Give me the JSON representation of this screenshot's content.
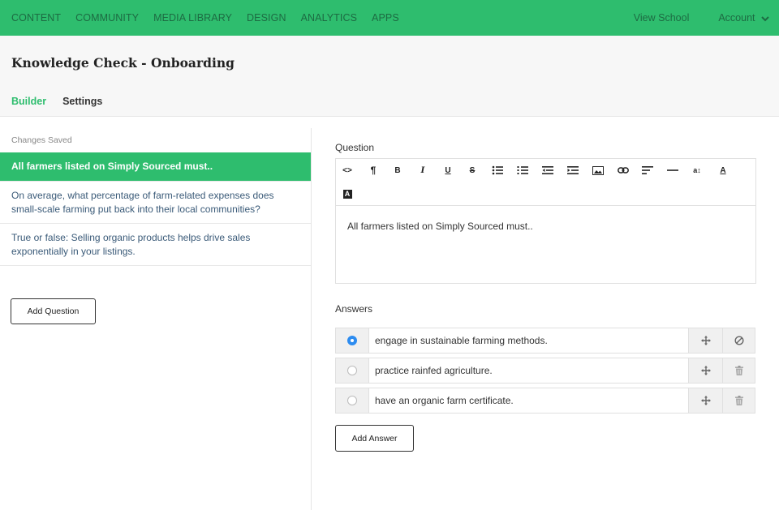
{
  "nav": {
    "left": [
      "CONTENT",
      "COMMUNITY",
      "MEDIA LIBRARY",
      "DESIGN",
      "ANALYTICS",
      "APPS"
    ],
    "view_school": "View School",
    "account": "Account"
  },
  "header": {
    "title": "Knowledge Check - Onboarding",
    "tabs": [
      {
        "label": "Builder",
        "active": true
      },
      {
        "label": "Settings",
        "active": false
      }
    ]
  },
  "sidebar": {
    "status": "Changes Saved",
    "questions": [
      "All farmers listed on Simply Sourced must..",
      "On average, what percentage of farm-related expenses does small-scale farming put back into their local communities?",
      "True or false: Selling organic products helps drive sales exponentially in your listings."
    ],
    "add_question": "Add Question"
  },
  "editor": {
    "question_label": "Question",
    "content": "All farmers listed on Simply Sourced must..",
    "toolbar_icons": [
      "code-icon",
      "paragraph-icon",
      "bold-icon",
      "italic-icon",
      "underline-icon",
      "strikethrough-icon",
      "unordered-list-icon",
      "ordered-list-icon",
      "outdent-icon",
      "indent-icon",
      "image-icon",
      "link-icon",
      "align-icon",
      "horizontal-rule-icon",
      "font-size-icon",
      "font-color-icon",
      "background-color-icon"
    ],
    "toolbar_glyphs": {
      "code": "<>",
      "paragraph": "¶",
      "bold": "B",
      "italic": "I",
      "underline": "U",
      "strike": "S",
      "font_size": "a↕",
      "font_color": "A",
      "bg_color": "A"
    }
  },
  "answers": {
    "label": "Answers",
    "items": [
      {
        "text": "engage in sustainable farming methods.",
        "correct": true
      },
      {
        "text": "practice rainfed agriculture.",
        "correct": false
      },
      {
        "text": "have an organic farm certificate.",
        "correct": false
      }
    ],
    "add_answer": "Add Answer"
  },
  "colors": {
    "accent": "#2ebd6e",
    "nav_text": "#1d6b42",
    "radio_checked": "#2d8cf0"
  }
}
